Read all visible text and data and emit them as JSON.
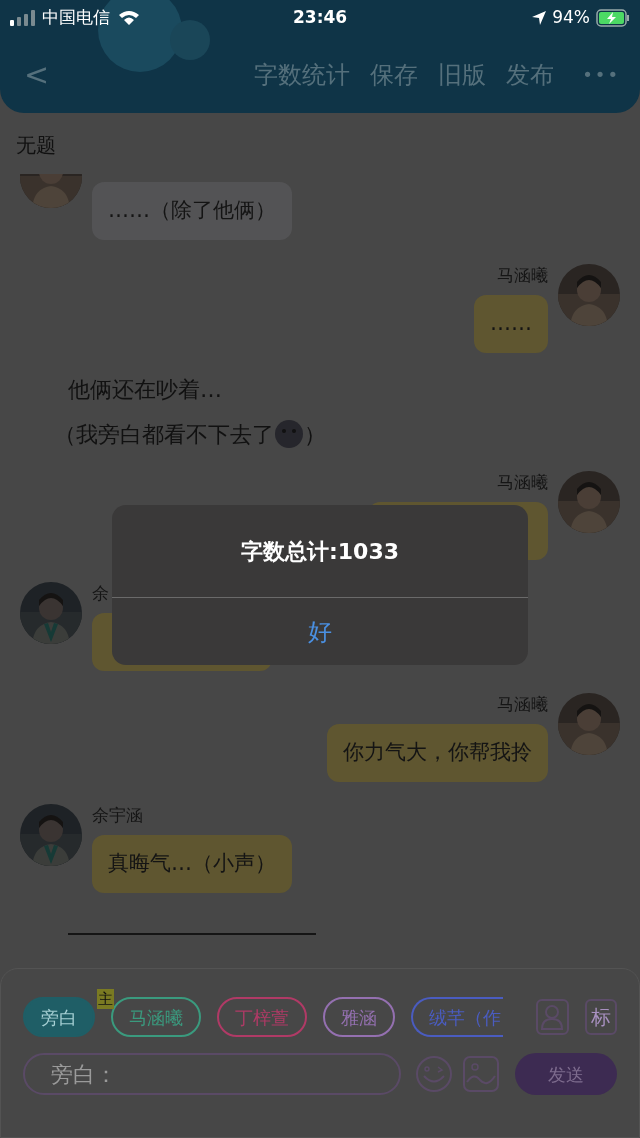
{
  "status_bar": {
    "carrier": "中国电信",
    "time": "23:46",
    "battery": "94%"
  },
  "header": {
    "back": "<",
    "actions": [
      "字数统计",
      "保存",
      "旧版",
      "发布"
    ],
    "more": "•••"
  },
  "title": "无题",
  "messages": [
    {
      "kind": "left",
      "text": "……（除了他俩）",
      "highlight": false,
      "cut_top": true
    },
    {
      "kind": "right",
      "name": "马涵曦",
      "text": "……",
      "highlight": true
    },
    {
      "kind": "narration",
      "lines": [
        [
          {
            "kind": "text",
            "text": "他俩还在吵着…"
          }
        ],
        [
          {
            "kind": "text",
            "text": "（我旁白都看不下去了"
          },
          {
            "kind": "emoji"
          },
          {
            "kind": "text",
            "text": "）"
          }
        ]
      ]
    },
    {
      "kind": "right",
      "name": "马涵曦",
      "highlight": true
    },
    {
      "kind": "left",
      "name": "余",
      "highlight": true
    },
    {
      "kind": "right",
      "name": "马涵曦",
      "text": "你力气大，你帮我拎",
      "highlight": true
    },
    {
      "kind": "left",
      "name": "余宇涵",
      "text": "真晦气…（小声）",
      "highlight": true
    }
  ],
  "alert": {
    "message": "字数总计:1033",
    "button": "好"
  },
  "roles": [
    {
      "label": "旁白",
      "selected": true,
      "color": "#1f5e66"
    },
    {
      "label": "马涵曦",
      "selected": false,
      "color": "#3a9a7e",
      "badge": "主"
    },
    {
      "label": "丁梓萱",
      "selected": false,
      "color": "#b03a66"
    },
    {
      "label": "雅涵",
      "selected": false,
      "color": "#9470b0"
    },
    {
      "label": "绒芊（作",
      "selected": false,
      "color": "#4a5cc0"
    }
  ],
  "mark_button": "标",
  "input": {
    "placeholder": "旁白："
  },
  "send": "发送"
}
